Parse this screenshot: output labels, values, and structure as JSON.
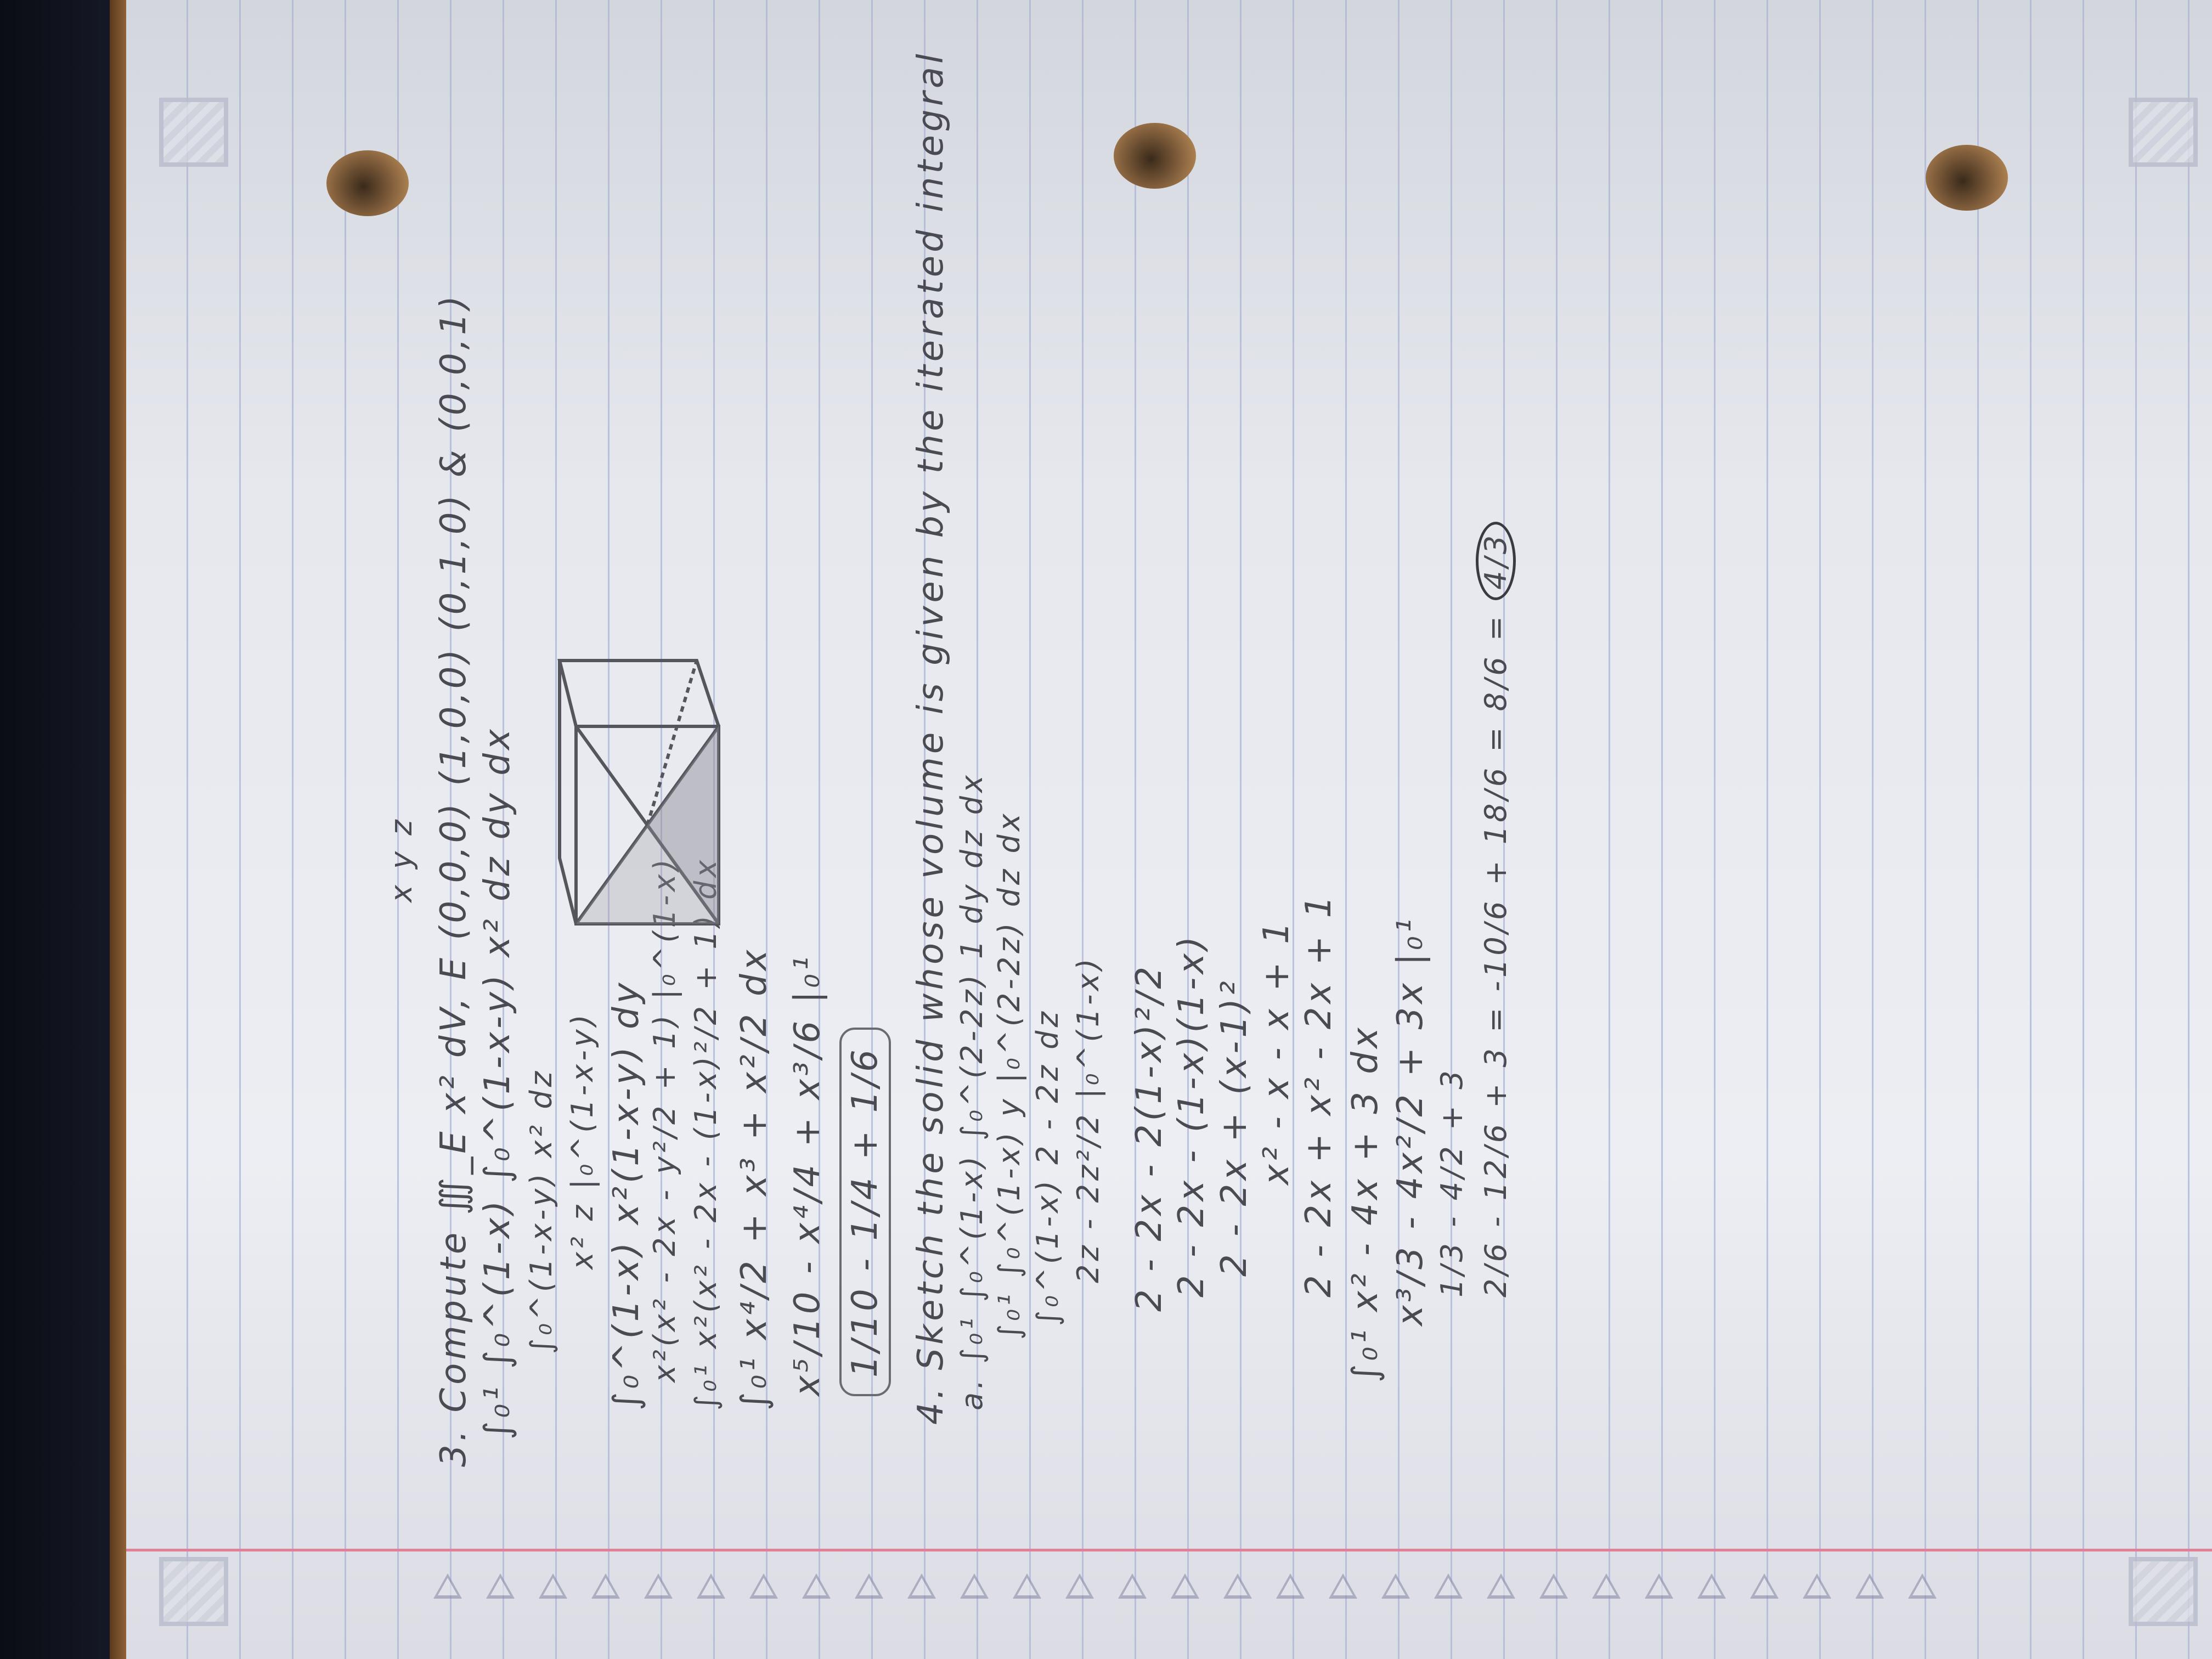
{
  "problem3": {
    "heading": "3. Compute ∭_E x² dV,  E (0,0,0) (1,0,0) (0,1,0) & (0,0,1)",
    "axes_label": "x y z",
    "steps": [
      "∫₀¹ ∫₀^(1-x) ∫₀^(1-x-y) x² dz dy dx",
      "∫₀^(1-x-y) x² dz",
      "x² z |₀^(1-x-y)",
      "∫₀^(1-x) x²(1-x-y) dy",
      "x²(x² - 2x - y²/2 + 1) |₀^(1-x)",
      "∫₀¹ x²(x² - 2x - (1-x)²/2 + 1) dx",
      "∫₀¹ x⁴/2 + x³ + x²/2 dx",
      "x⁵/10 - x⁴/4 + x³/6 |₀¹"
    ],
    "boxed_answer": "1/10 - 1/4 + 1/6"
  },
  "problem4": {
    "heading": "4. Sketch the solid whose volume is given by the iterated integral",
    "part_a": "a. ∫₀¹ ∫₀^(1-x) ∫₀^(2-2z) 1 dy dz dx",
    "steps": [
      "∫₀¹ ∫₀^(1-x) y |₀^(2-2z) dz dx",
      "∫₀^(1-x) 2 - 2z dz",
      "2z - 2z²/2 |₀^(1-x)",
      "2 - 2x - 2(1-x)²/2",
      "2 - 2x - (1-x)(1-x)",
      "2 - 2x + (x-1)²",
      "x² - x - x + 1",
      "2 - 2x + x² - 2x + 1",
      "∫₀¹ x² - 4x + 3 dx",
      "x³/3 - 4x²/2 + 3x |₀¹",
      "1/3 - 4/2 + 3"
    ],
    "final_line": "2/6 - 12/6 + 3 = -10/6 + 18/6 = 8/6 =",
    "final_answer": "4/3"
  }
}
